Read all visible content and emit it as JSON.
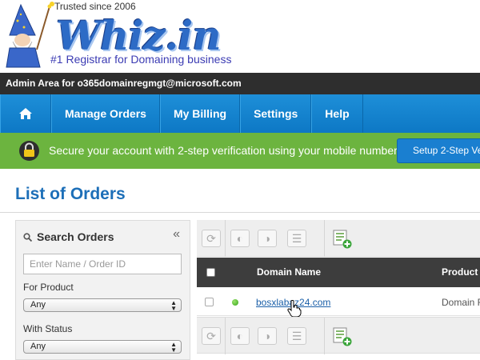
{
  "header": {
    "trusted": "Trusted since 2006",
    "logo_text": "Whiz.in",
    "tagline": "#1 Registrar for Domaining business"
  },
  "admin_bar": {
    "text": "Admin Area for o365domainregmgt@microsoft.com"
  },
  "nav": {
    "home_icon": "home-icon",
    "items": [
      {
        "label": "Manage Orders"
      },
      {
        "label": "My Billing"
      },
      {
        "label": "Settings"
      },
      {
        "label": "Help"
      }
    ]
  },
  "banner": {
    "icon": "lock-icon",
    "text": "Secure your account with 2-step verification using your mobile number.",
    "button_label": "Setup 2-Step Ve"
  },
  "page": {
    "title": "List of Orders"
  },
  "search": {
    "heading": "Search Orders",
    "collapse_label": "«",
    "input_placeholder": "Enter Name / Order ID",
    "product_label": "For Product",
    "product_value": "Any",
    "status_label": "With Status",
    "status_value": "Any"
  },
  "table": {
    "columns": [
      "Domain Name",
      "Product"
    ],
    "rows": [
      {
        "status_color": "#35a51b",
        "domain": "bosxlabaz24.com",
        "product": "Domain R"
      }
    ]
  },
  "colors": {
    "nav_blue": "#1485d0",
    "banner_green": "#6cb43f",
    "title_blue": "#1d6fb8",
    "admin_bar": "#2e2e2e"
  }
}
